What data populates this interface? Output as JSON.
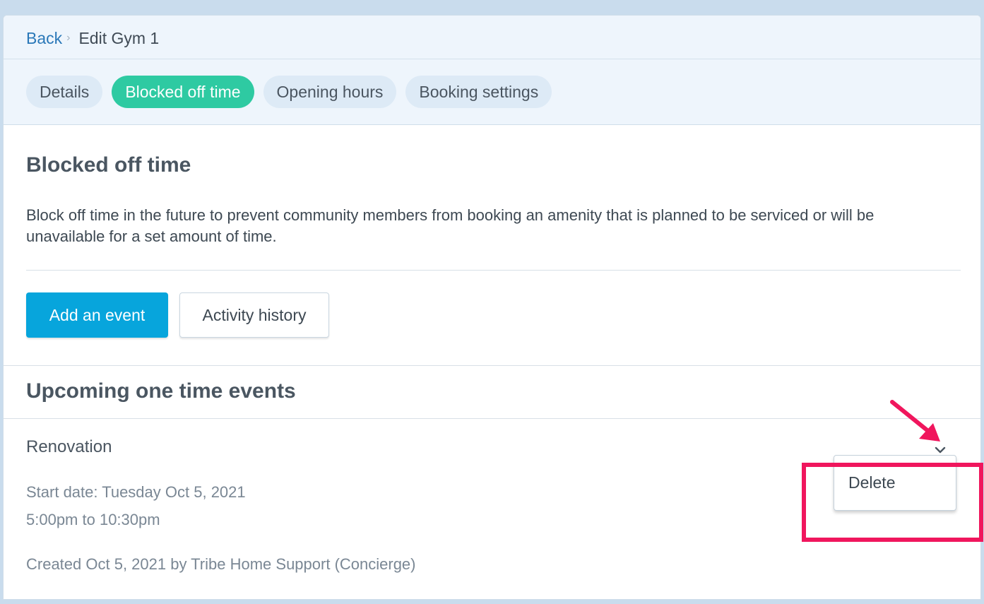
{
  "breadcrumb": {
    "back_label": "Back",
    "separator": "›",
    "title": "Edit Gym 1"
  },
  "tabs": [
    {
      "label": "Details",
      "active": false
    },
    {
      "label": "Blocked off time",
      "active": true
    },
    {
      "label": "Opening hours",
      "active": false
    },
    {
      "label": "Booking settings",
      "active": false
    }
  ],
  "section": {
    "title": "Blocked off time",
    "description": "Block off time in the future to prevent community members from booking an amenity that is planned to be serviced or will be unavailable for a set amount of time."
  },
  "actions": {
    "add_event_label": "Add an event",
    "activity_history_label": "Activity history"
  },
  "upcoming": {
    "title": "Upcoming one time events",
    "events": [
      {
        "name": "Renovation",
        "start_date": "Start date: Tuesday Oct 5, 2021",
        "time_range": "5:00pm to 10:30pm",
        "created": "Created Oct 5, 2021 by Tribe Home Support (Concierge)"
      }
    ]
  },
  "dropdown_menu": {
    "items": [
      {
        "label": "Delete"
      }
    ]
  },
  "annotations": {
    "highlight_color": "#f0165d",
    "arrow_color": "#f0165d"
  },
  "colors": {
    "active_tab": "#2ecaa2",
    "primary_button": "#07a5dc",
    "link": "#2a78b8"
  }
}
